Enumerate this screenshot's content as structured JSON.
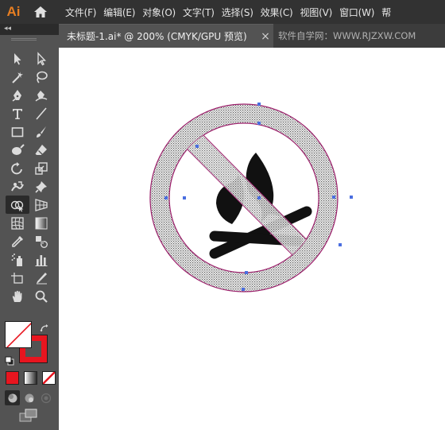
{
  "app": {
    "logo": "Ai"
  },
  "menu": {
    "items": [
      "文件(F)",
      "编辑(E)",
      "对象(O)",
      "文字(T)",
      "选择(S)",
      "效果(C)",
      "视图(V)",
      "窗口(W)",
      "帮"
    ]
  },
  "toolbar_panel": {
    "collapse_label": "◂◂"
  },
  "tabs": {
    "active_label": "未标题-1.ai* @ 200% (CMYK/GPU 预览)",
    "close_label": "×",
    "inactive_label": "软件自学网：WWW.RJZXW.COM"
  },
  "tools": [
    "selection-tool",
    "direct-selection-tool",
    "magic-wand-tool",
    "lasso-tool",
    "pen-tool",
    "curvature-tool",
    "type-tool",
    "line-segment-tool",
    "rectangle-tool",
    "paintbrush-tool",
    "blob-brush-tool",
    "eraser-tool",
    "rotate-tool",
    "scale-tool",
    "puppet-warp-tool",
    "pin-tool",
    "shape-builder-tool",
    "perspective-grid-tool",
    "mesh-tool",
    "gradient-tool",
    "eyedropper-tool",
    "blend-tool",
    "symbol-sprayer-tool",
    "column-graph-tool",
    "artboard-tool",
    "slice-tool",
    "hand-tool",
    "zoom-tool"
  ],
  "colors": {
    "fill": "#ffffff",
    "stroke": "#e8151f",
    "selection": "#4a6ee0",
    "path_highlight": "#b0226e"
  }
}
